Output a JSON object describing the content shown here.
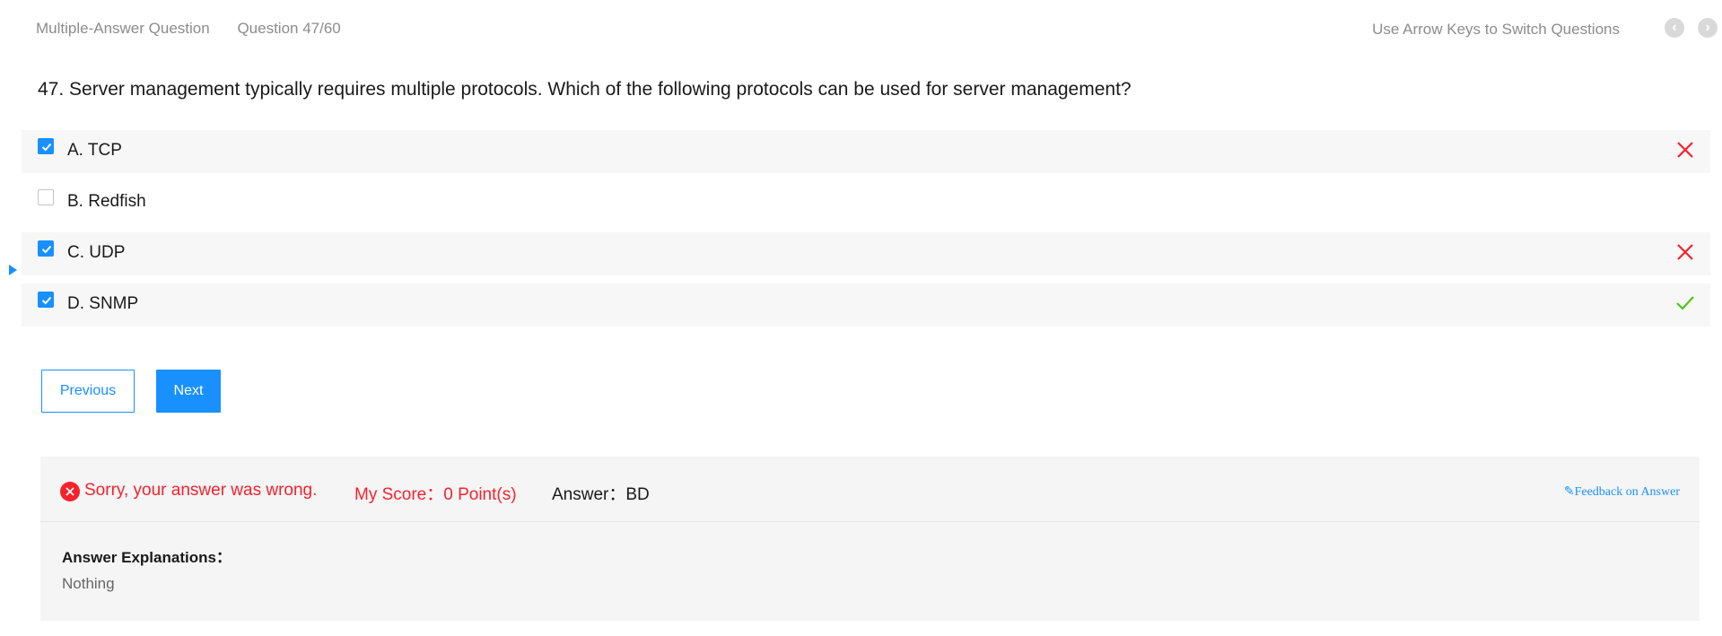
{
  "header": {
    "question_type": "Multiple-Answer Question",
    "progress": "Question 47/60",
    "nav_hint": "Use Arrow Keys to Switch Questions",
    "prev_icon": "chevron-left-icon",
    "next_icon": "chevron-right-icon"
  },
  "question": {
    "text": "47. Server management typically requires multiple protocols. Which of the following protocols can be used for server management?"
  },
  "options": [
    {
      "label": "A. TCP",
      "checked": true,
      "result": "wrong"
    },
    {
      "label": "B. Redfish",
      "checked": false,
      "result": "none"
    },
    {
      "label": "C. UDP",
      "checked": true,
      "result": "wrong"
    },
    {
      "label": "D. SNMP",
      "checked": true,
      "result": "correct"
    }
  ],
  "buttons": {
    "previous_label": "Previous",
    "next_label": "Next"
  },
  "result": {
    "status_icon": "close-circle-icon",
    "message": "Sorry, your answer was wrong.",
    "score": "My Score：0 Point(s)",
    "answer": "Answer：BD",
    "feedback_icon": "edit-icon",
    "feedback_label": "Feedback on Answer"
  },
  "explanation": {
    "title": "Answer Explanations：",
    "body": "Nothing"
  },
  "colors": {
    "accent": "#1890ff",
    "error": "#f5222d",
    "success": "#52c41a"
  }
}
